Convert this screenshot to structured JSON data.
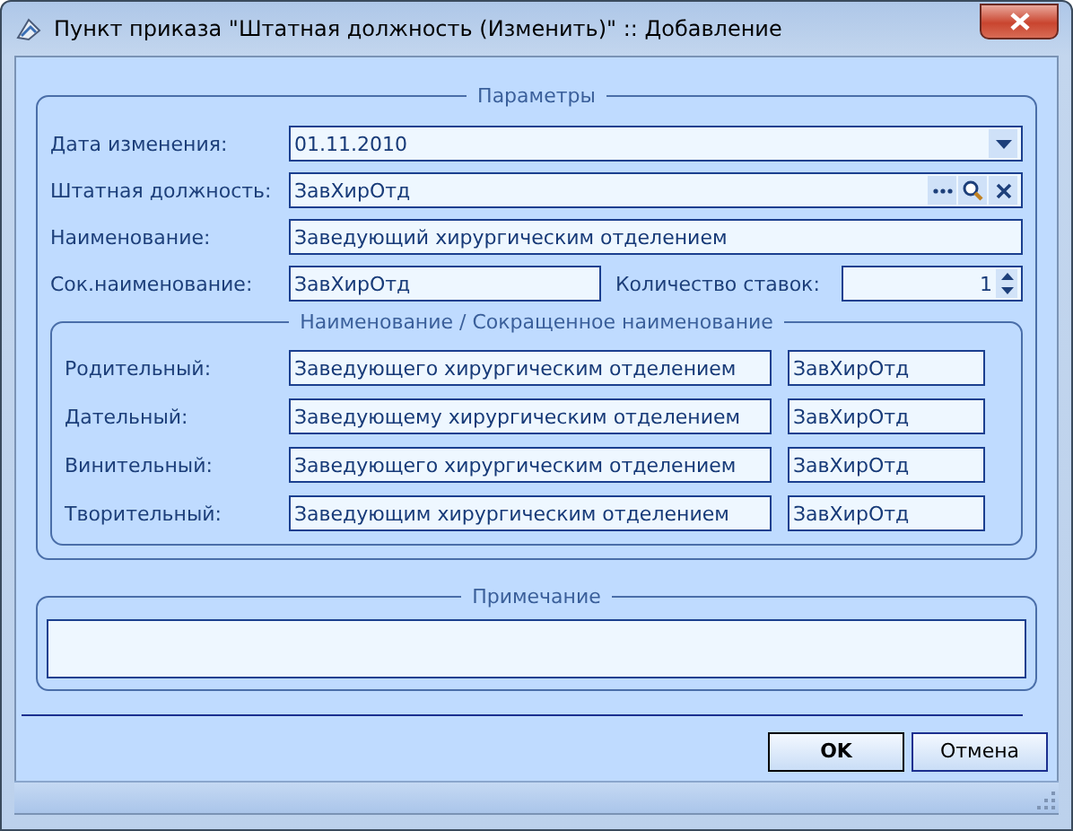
{
  "window": {
    "title": "Пункт приказа \"Штатная должность (Изменить)\" :: Добавление"
  },
  "parameters": {
    "title": "Параметры",
    "date": {
      "label": "Дата изменения:",
      "value": "01.11.2010"
    },
    "position": {
      "label": "Штатная должность:",
      "value": "ЗавХирОтд"
    },
    "name": {
      "label": "Наименование:",
      "value": "Заведующий хирургическим отделением"
    },
    "short_name": {
      "label": "Сок.наименование:",
      "value": "ЗавХирОтд"
    },
    "rate_count": {
      "label": "Количество ставок:",
      "value": "1"
    },
    "cases": {
      "title": "Наименование / Сокращенное наименование",
      "rows": [
        {
          "label": "Родительный:",
          "full": "Заведующего хирургическим отделением",
          "short": "ЗавХирОтд"
        },
        {
          "label": "Дательный:",
          "full": "Заведующему хирургическим отделением",
          "short": "ЗавХирОтд"
        },
        {
          "label": "Винительный:",
          "full": "Заведующего хирургическим отделением",
          "short": "ЗавХирОтд"
        },
        {
          "label": "Творительный:",
          "full": "Заведующим хирургическим отделением",
          "short": "ЗавХирОтд"
        }
      ]
    }
  },
  "note": {
    "title": "Примечание"
  },
  "buttons": [
    {
      "label": "OK",
      "default": true
    },
    {
      "label": "Отмена",
      "default": false
    }
  ]
}
